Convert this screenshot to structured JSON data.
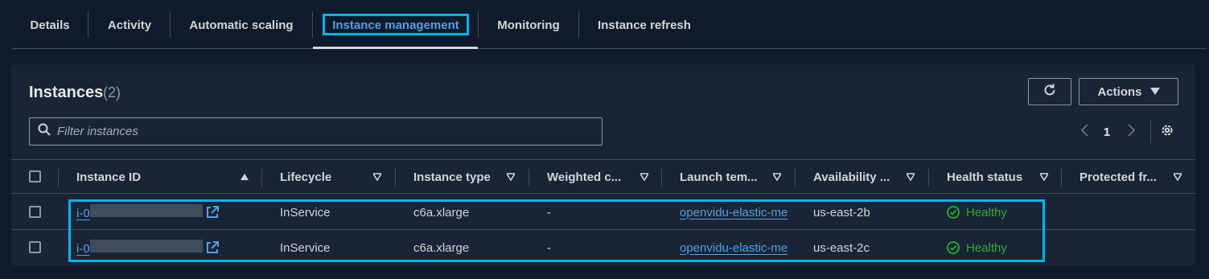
{
  "tabs": [
    {
      "label": "Details"
    },
    {
      "label": "Activity"
    },
    {
      "label": "Automatic scaling"
    },
    {
      "label": "Instance management",
      "active": true
    },
    {
      "label": "Monitoring"
    },
    {
      "label": "Instance refresh"
    }
  ],
  "panel": {
    "title": "Instances",
    "count": "(2)",
    "refresh_icon": "refresh-icon",
    "actions_label": "Actions",
    "search_placeholder": "Filter instances",
    "page": "1"
  },
  "columns": [
    "Instance ID",
    "Lifecycle",
    "Instance type",
    "Weighted c...",
    "Launch tem...",
    "Availability ...",
    "Health status",
    "Protected fr..."
  ],
  "rows": [
    {
      "instance_id": "i-0",
      "lifecycle": "InService",
      "instance_type": "c6a.xlarge",
      "weighted": "-",
      "launch_template": "openvidu-elastic-me",
      "az": "us-east-2b",
      "health": "Healthy"
    },
    {
      "instance_id": "i-0",
      "lifecycle": "InService",
      "instance_type": "c6a.xlarge",
      "weighted": "-",
      "launch_template": "openvidu-elastic-me",
      "az": "us-east-2c",
      "health": "Healthy"
    }
  ],
  "colors": {
    "background": "#0f1b2a",
    "panel": "#192534",
    "link": "#539fe5",
    "healthy": "#29ad32",
    "highlight": "#00b4f0"
  }
}
